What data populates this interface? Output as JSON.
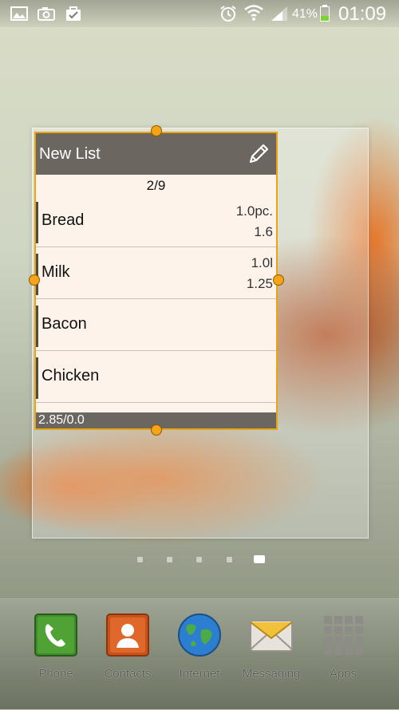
{
  "status_bar": {
    "battery_percent": "41%",
    "battery_level": 0.41,
    "time": "01:09",
    "icons": [
      "gallery-icon",
      "camera-icon",
      "shopping-bag-icon",
      "alarm-icon",
      "wifi-icon",
      "signal-icon",
      "battery-icon"
    ]
  },
  "list_widget": {
    "title": "New List",
    "page_indicator": "2/9",
    "items": [
      {
        "name": "Bread",
        "quantity": "1.0pc.",
        "price": "1.6"
      },
      {
        "name": "Milk",
        "quantity": "1.0l",
        "price": "1.25"
      },
      {
        "name": "Bacon",
        "quantity": "",
        "price": ""
      },
      {
        "name": "Chicken",
        "quantity": "",
        "price": ""
      }
    ],
    "total": "2.85/0.0",
    "accent_color": "#e8a413",
    "header_color": "#6b6660"
  },
  "home_pages": {
    "count": 5,
    "active_index": 4
  },
  "dock": {
    "items": [
      {
        "label": "Phone",
        "icon": "phone-icon"
      },
      {
        "label": "Contacts",
        "icon": "contacts-icon"
      },
      {
        "label": "Internet",
        "icon": "globe-icon"
      },
      {
        "label": "Messaging",
        "icon": "envelope-icon"
      },
      {
        "label": "Apps",
        "icon": "apps-grid-icon"
      }
    ]
  }
}
